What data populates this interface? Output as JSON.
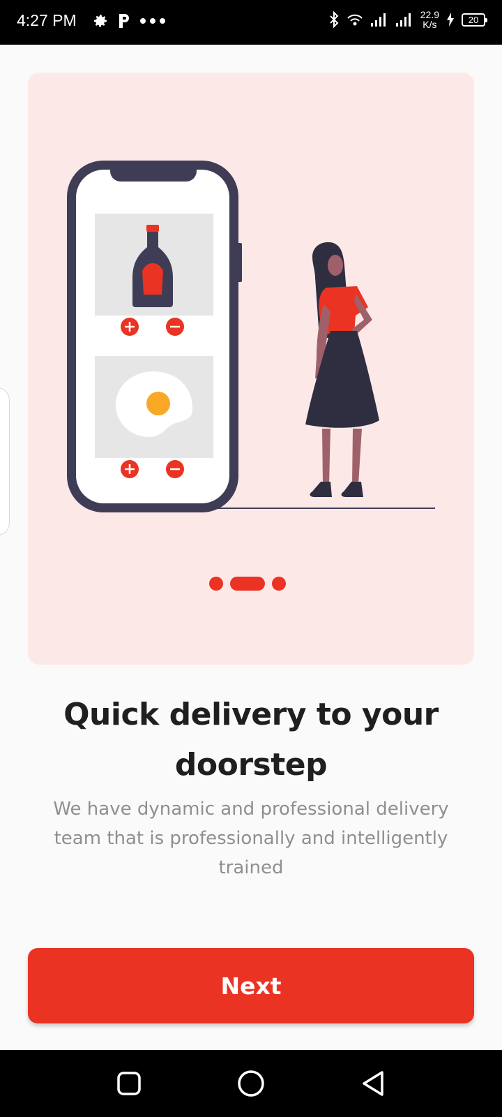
{
  "status_bar": {
    "time": "4:27 PM",
    "left_icons": [
      "gear-icon",
      "p-icon",
      "more-dots-icon"
    ],
    "right_icons": [
      "bluetooth-icon",
      "wifi-icon",
      "signal-icon",
      "signal-icon-2"
    ],
    "speed_value": "22.9",
    "speed_unit": "K/s",
    "battery_level": "20"
  },
  "hero": {
    "background": "#fde8e8",
    "illustration": "phone-with-products-and-woman",
    "accent": "#ea3323",
    "dark": "#3f3d56"
  },
  "pagination": {
    "count": 3,
    "active_index": 1
  },
  "content": {
    "title": "Quick delivery to your doorstep",
    "subtitle": "We have dynamic and professional delivery team that is professionally and intelligently trained"
  },
  "actions": {
    "next_label": "Next",
    "color": "#ea3323"
  },
  "nav_bar": {
    "buttons": [
      "recents-button",
      "home-button",
      "back-button"
    ]
  }
}
